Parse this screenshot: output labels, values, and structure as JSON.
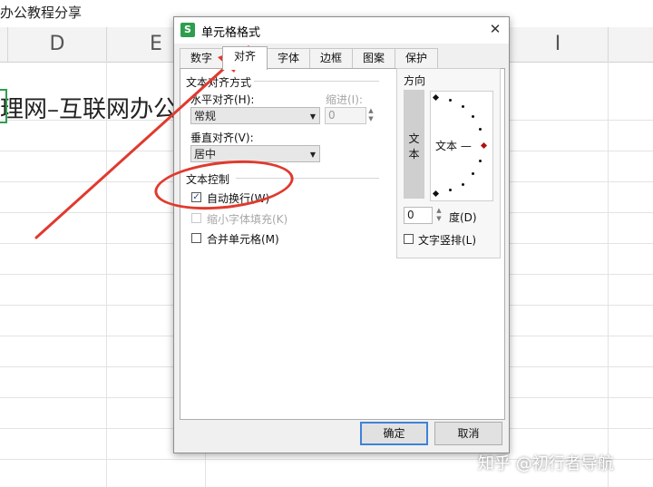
{
  "sheet": {
    "top_text": "办公教程分享",
    "columns": [
      "D",
      "E",
      "I"
    ],
    "cell_text": "理网–互联网办公教"
  },
  "dialog": {
    "app_icon": "S",
    "title": "单元格格式",
    "close_label": "✕",
    "tabs": [
      "数字",
      "对齐",
      "字体",
      "边框",
      "图案",
      "保护"
    ],
    "active_tab": "对齐",
    "text_alignment": {
      "group_label": "文本对齐方式",
      "horizontal_label": "水平对齐(H):",
      "horizontal_value": "常规",
      "indent_label": "缩进(I):",
      "indent_value": "0",
      "vertical_label": "垂直对齐(V):",
      "vertical_value": "居中"
    },
    "text_control": {
      "group_label": "文本控制",
      "wrap_label": "自动换行(W)",
      "wrap_checked": true,
      "shrink_label": "缩小字体填充(K)",
      "shrink_checked": false,
      "merge_label": "合并单元格(M)",
      "merge_checked": false
    },
    "direction": {
      "group_label": "方向",
      "vertical_text_button": "文\n本",
      "orientation_text": "文本 —",
      "degree_value": "0",
      "degree_label": "度(D)",
      "vertical_text_checkbox_label": "文字竖排(L)",
      "vertical_text_checked": false
    },
    "buttons": {
      "ok": "确定",
      "cancel": "取消"
    }
  },
  "annotations": {
    "arrow_color": "#e03a2e",
    "ellipse_color": "#e03a2e"
  },
  "watermark": "知乎 @初行者导航",
  "icons": [
    "app-icon",
    "close-icon",
    "dropdown-arrow-icon",
    "spin-arrows-icon",
    "checkmark-icon"
  ]
}
